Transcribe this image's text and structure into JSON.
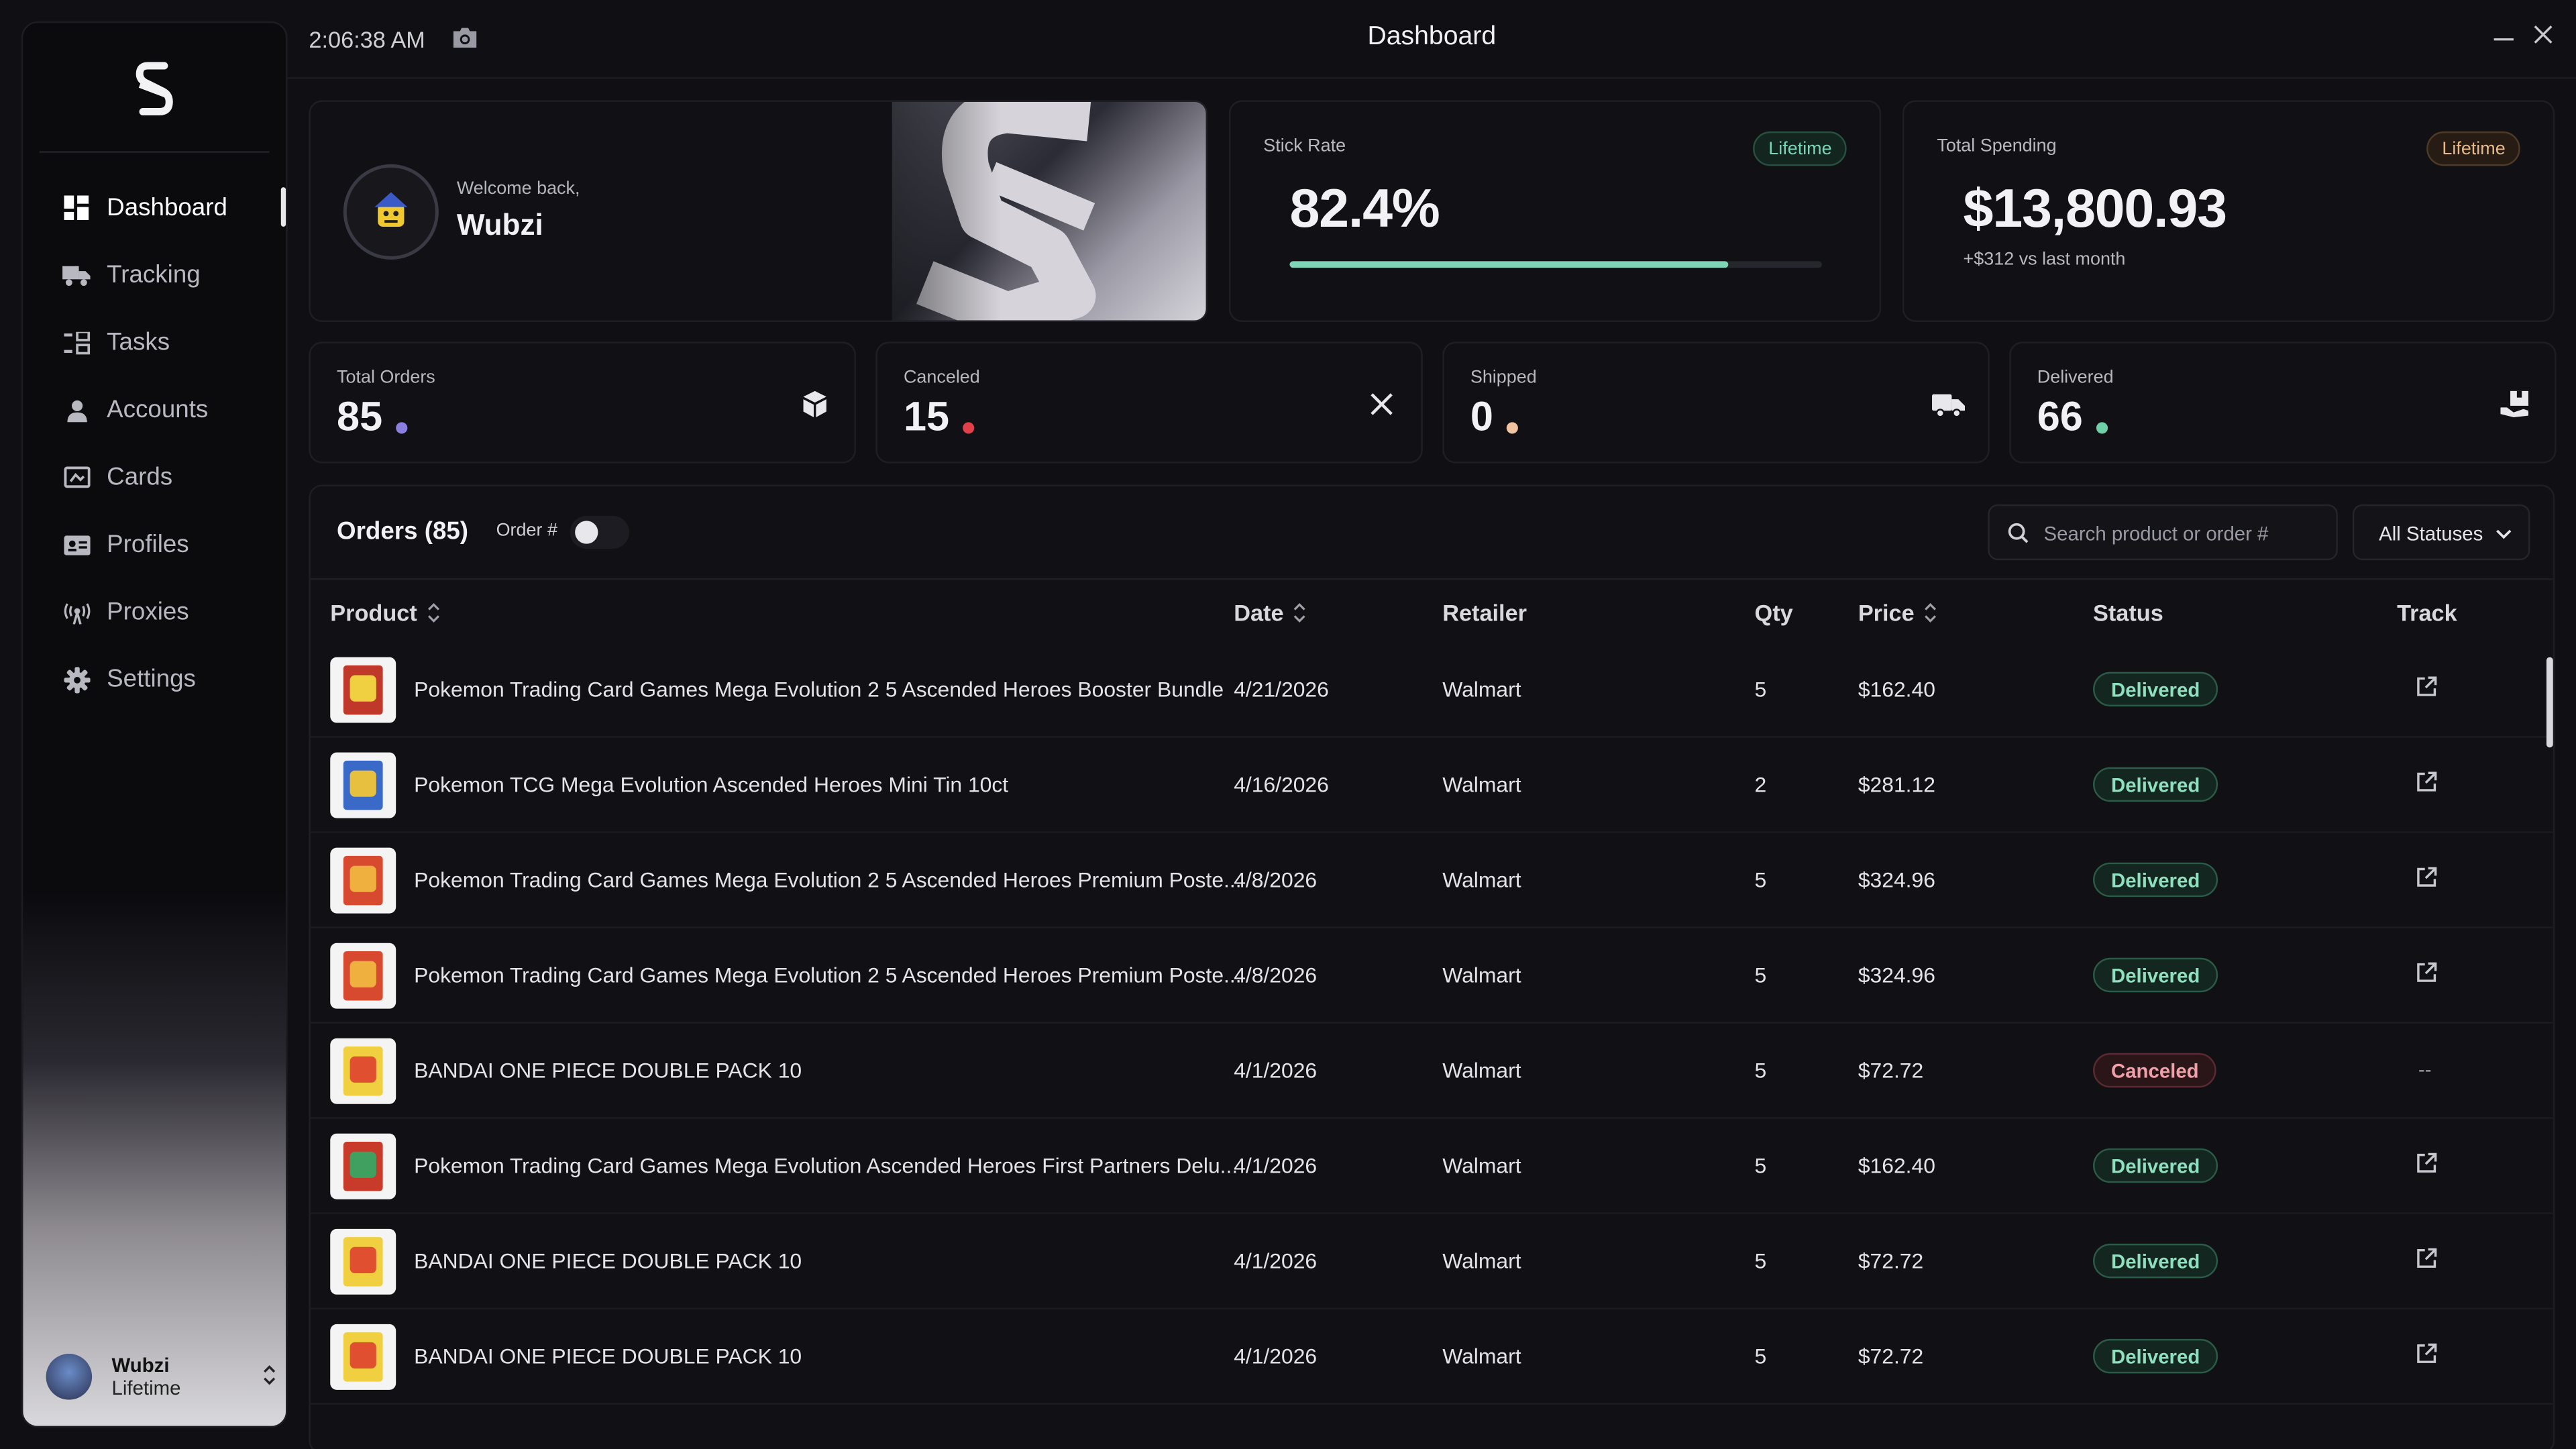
{
  "app": {
    "title": "Dashboard",
    "clock": "2:06:38 AM"
  },
  "sidebar": {
    "items": [
      {
        "label": "Dashboard",
        "icon": "dashboard-icon",
        "active": true
      },
      {
        "label": "Tracking",
        "icon": "truck-icon"
      },
      {
        "label": "Tasks",
        "icon": "tasks-icon"
      },
      {
        "label": "Accounts",
        "icon": "user-icon"
      },
      {
        "label": "Cards",
        "icon": "card-icon"
      },
      {
        "label": "Profiles",
        "icon": "id-card-icon"
      },
      {
        "label": "Proxies",
        "icon": "antenna-icon"
      },
      {
        "label": "Settings",
        "icon": "gear-icon"
      }
    ],
    "user": {
      "name": "Wubzi",
      "plan": "Lifetime"
    }
  },
  "welcome": {
    "subtitle": "Welcome back,",
    "name": "Wubzi"
  },
  "stick_rate": {
    "label": "Stick Rate",
    "badge": "Lifetime",
    "value": "82.4%",
    "progress": 0.824
  },
  "total_spending": {
    "label": "Total Spending",
    "badge": "Lifetime",
    "value": "$13,800.93",
    "note": "+$312 vs last month"
  },
  "stats": [
    {
      "label": "Total Orders",
      "value": "85",
      "dot_color": "#8a7fe0",
      "icon": "package-icon"
    },
    {
      "label": "Canceled",
      "value": "15",
      "dot_color": "#e0404a",
      "icon": "close-icon"
    },
    {
      "label": "Shipped",
      "value": "0",
      "dot_color": "#f0c4a0",
      "icon": "truck-icon"
    },
    {
      "label": "Delivered",
      "value": "66",
      "dot_color": "#6fd0a8",
      "icon": "delivered-box-icon"
    }
  ],
  "orders": {
    "title": "Orders (85)",
    "toggle_label": "Order #",
    "search_placeholder": "Search product or order #",
    "status_filter": "All Statuses",
    "columns": {
      "product": "Product",
      "date": "Date",
      "retailer": "Retailer",
      "qty": "Qty",
      "price": "Price",
      "status": "Status",
      "track": "Track"
    },
    "rows": [
      {
        "product": "Pokemon Trading Card Games Mega Evolution 2 5 Ascended Heroes Booster Bundle",
        "date": "4/21/2026",
        "retailer": "Walmart",
        "qty": "5",
        "price": "$162.40",
        "status": "Delivered",
        "track": "link",
        "thumb": "booster-bundle"
      },
      {
        "product": "Pokemon TCG Mega Evolution Ascended Heroes Mini Tin 10ct",
        "date": "4/16/2026",
        "retailer": "Walmart",
        "qty": "2",
        "price": "$281.12",
        "status": "Delivered",
        "track": "link",
        "thumb": "mini-tin"
      },
      {
        "product": "Pokemon Trading Card Games Mega Evolution 2 5 Ascended Heroes Premium Poste...",
        "date": "4/8/2026",
        "retailer": "Walmart",
        "qty": "5",
        "price": "$324.96",
        "status": "Delivered",
        "track": "link",
        "thumb": "premium-poster"
      },
      {
        "product": "Pokemon Trading Card Games Mega Evolution 2 5 Ascended Heroes Premium Poste...",
        "date": "4/8/2026",
        "retailer": "Walmart",
        "qty": "5",
        "price": "$324.96",
        "status": "Delivered",
        "track": "link",
        "thumb": "premium-poster"
      },
      {
        "product": "BANDAI ONE PIECE DOUBLE PACK 10",
        "date": "4/1/2026",
        "retailer": "Walmart",
        "qty": "5",
        "price": "$72.72",
        "status": "Canceled",
        "track": "--",
        "thumb": "one-piece"
      },
      {
        "product": "Pokemon Trading Card Games Mega Evolution Ascended Heroes First Partners Delu...",
        "date": "4/1/2026",
        "retailer": "Walmart",
        "qty": "5",
        "price": "$162.40",
        "status": "Delivered",
        "track": "link",
        "thumb": "first-partners"
      },
      {
        "product": "BANDAI ONE PIECE DOUBLE PACK 10",
        "date": "4/1/2026",
        "retailer": "Walmart",
        "qty": "5",
        "price": "$72.72",
        "status": "Delivered",
        "track": "link",
        "thumb": "one-piece"
      },
      {
        "product": "BANDAI ONE PIECE DOUBLE PACK 10",
        "date": "4/1/2026",
        "retailer": "Walmart",
        "qty": "5",
        "price": "$72.72",
        "status": "Delivered",
        "track": "link",
        "thumb": "one-piece"
      }
    ]
  }
}
